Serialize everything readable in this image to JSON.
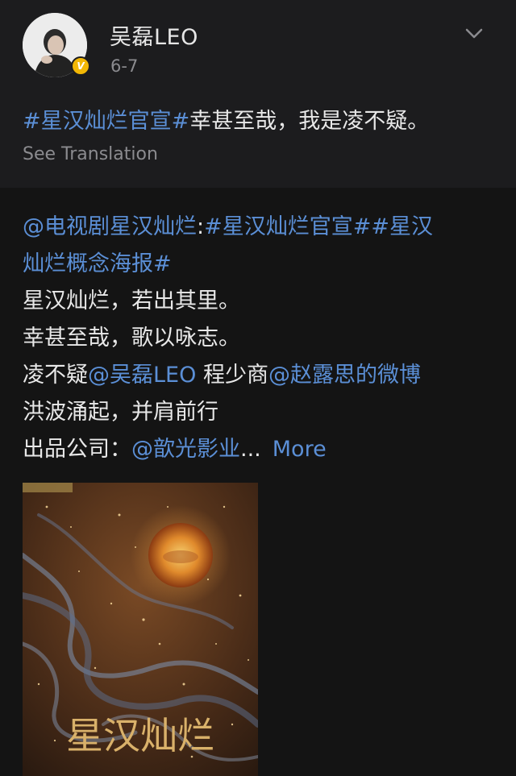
{
  "post": {
    "username": "吴磊LEO",
    "date": "6-7",
    "verified_badge": "V",
    "text_hashtag": "#星汉灿烂官宣#",
    "text_body": "幸甚至哉，我是凌不疑。",
    "translate_label": "See Translation"
  },
  "repost": {
    "line1": {
      "mention": "@电视剧星汉灿烂",
      "colon": ":",
      "hashtags": "#星汉灿烂官宣##星汉"
    },
    "line2": {
      "hashtag_cont": "灿烂概念海报#"
    },
    "line3": "星汉灿烂，若出其里。",
    "line4": "幸甚至哉，歌以咏志。",
    "line5": {
      "text1": "凌不疑",
      "mention1": "@吴磊LEO",
      "text2": " 程少商",
      "mention2": "@赵露思的微博"
    },
    "line6": "洪波涌起，并肩前行",
    "line7": {
      "text": "出品公司：",
      "mention": "@歆光影业",
      "ellipsis": "...",
      "more_label": "More"
    },
    "poster_title": "星汉灿烂"
  },
  "colors": {
    "link": "#5b8fd6",
    "background": "#121212",
    "post_bg": "#1c1c1e",
    "verified": "#f2b705"
  },
  "icons": [
    "chevron-down-icon",
    "verified-icon"
  ]
}
